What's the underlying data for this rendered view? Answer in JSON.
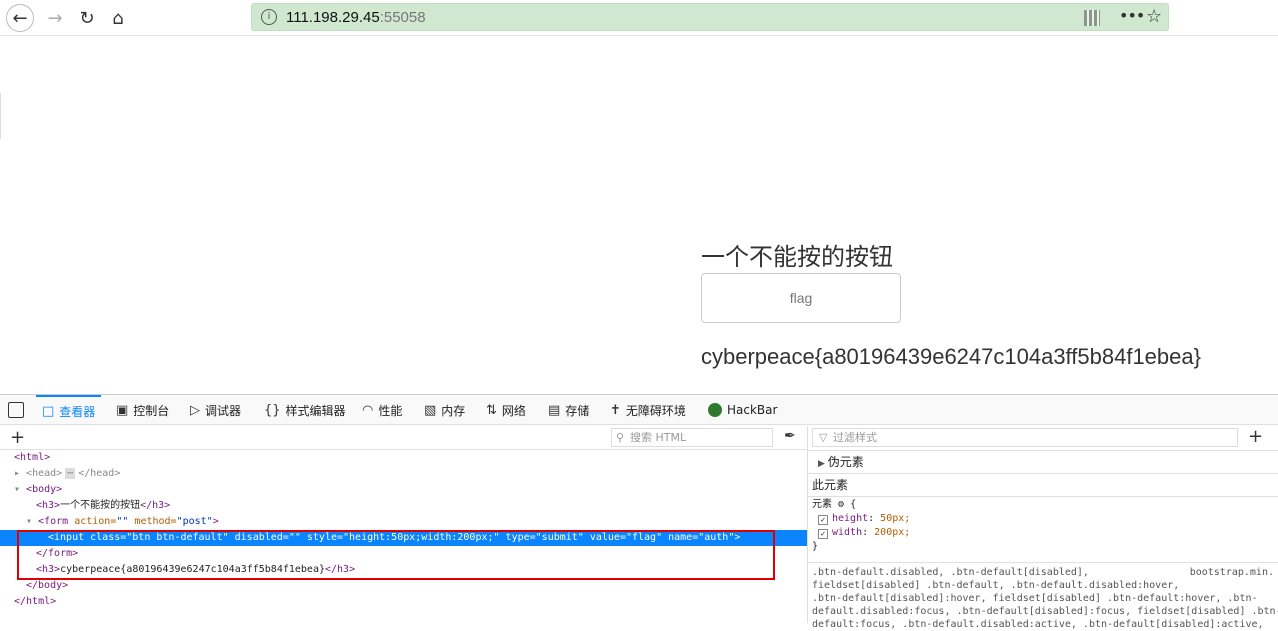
{
  "browser": {
    "url_host": "111.198.29.45",
    "url_port": ":55058",
    "icons": [
      "back-icon",
      "forward-icon",
      "reload-icon",
      "home-icon",
      "info-icon",
      "qr-code-icon",
      "more-icon",
      "star-icon"
    ]
  },
  "page": {
    "heading": "一个不能按的按钮",
    "button_label": "flag",
    "flag_text": "cyberpeace{a80196439e6247c104a3ff5b84f1ebea}"
  },
  "devtools": {
    "tabs": [
      {
        "label": "查看器",
        "icon": "inspector-icon"
      },
      {
        "label": "控制台",
        "icon": "console-icon"
      },
      {
        "label": "调试器",
        "icon": "debugger-icon"
      },
      {
        "label": "样式编辑器",
        "icon": "style-editor-icon"
      },
      {
        "label": "性能",
        "icon": "performance-icon"
      },
      {
        "label": "内存",
        "icon": "memory-icon"
      },
      {
        "label": "网络",
        "icon": "network-icon"
      },
      {
        "label": "存储",
        "icon": "storage-icon"
      },
      {
        "label": "无障碍环境",
        "icon": "accessibility-icon"
      },
      {
        "label": "HackBar",
        "icon": "hackbar-icon"
      }
    ],
    "search_placeholder": "搜索 HTML",
    "filter_placeholder": "过滤样式",
    "markup": {
      "html_open": "<html>",
      "head_open": "<head>",
      "head_ellipsis": "⋯",
      "head_close": "</head>",
      "body_open": "<body>",
      "h3_open": "<h3>",
      "h3_text": "一个不能按的按钮",
      "h3_close": "</h3>",
      "form_tag": "<form",
      "form_attr1": "action=",
      "form_val1": "\"\"",
      "form_attr2": "method=",
      "form_val2": "\"post\"",
      "form_end": ">",
      "input_line": "<input class=\"btn btn-default\" disabled=\"\" style=\"height:50px;width:200px;\" type=\"submit\" value=\"flag\" name=\"auth\">",
      "form_close": "</form>",
      "h3b_text": "cyberpeace{a80196439e6247c104a3ff5b84f1ebea}",
      "body_close": "</body>",
      "html_close": "</html>"
    },
    "rules": {
      "pseudo_label": "伪元素",
      "this_element_label": "此元素",
      "element_label": "元素",
      "open_brace": "{",
      "close_brace": "}",
      "declarations": [
        {
          "prop": "height",
          "value": "50px;"
        },
        {
          "prop": "width",
          "value": "200px;"
        }
      ],
      "rule2_selector": ".btn-default.disabled, .btn-default[disabled],\nfieldset[disabled] .btn-default, .btn-default.disabled:hover,\n.btn-default[disabled]:hover, fieldset[disabled] .btn-default:hover, .btn-\ndefault.disabled:focus, .btn-default[disabled]:focus, fieldset[disabled] .btn-\ndefault:focus, .btn-default.disabled:active, .btn-default[disabled]:active,",
      "rule2_source": "bootstrap.min."
    }
  }
}
